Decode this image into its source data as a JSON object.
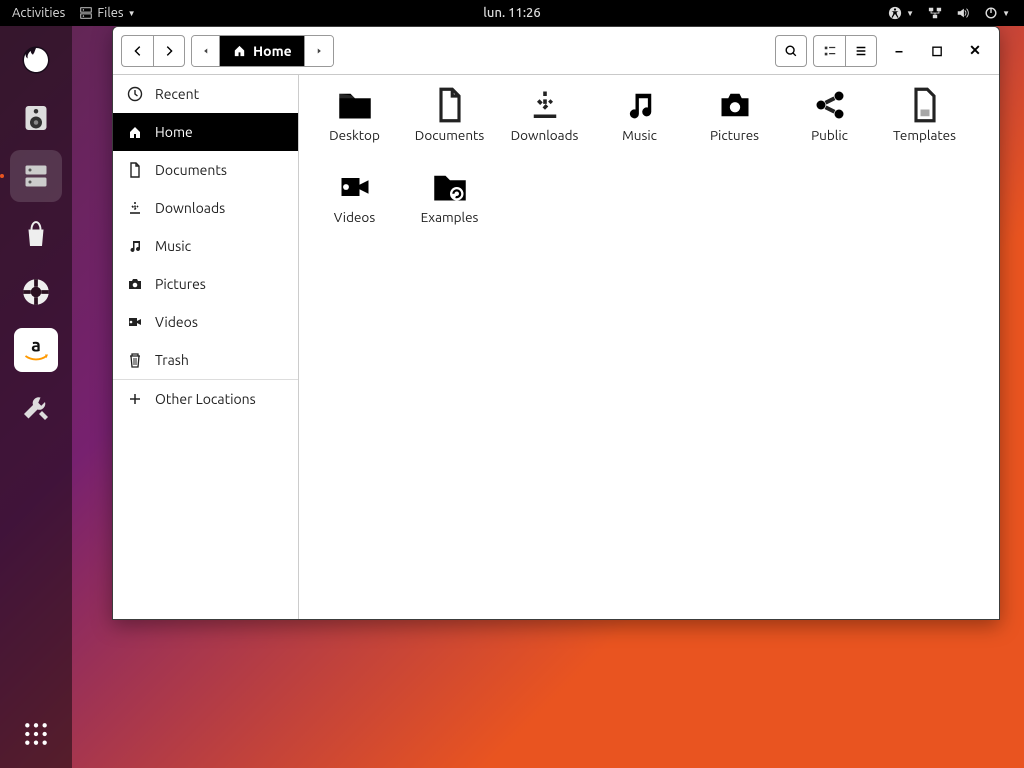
{
  "topbar": {
    "activities": "Activities",
    "app_menu": "Files",
    "clock": "lun. 11:26"
  },
  "window": {
    "path_label": "Home"
  },
  "sidebar": {
    "items": [
      {
        "id": "recent",
        "label": "Recent"
      },
      {
        "id": "home",
        "label": "Home",
        "selected": true
      },
      {
        "id": "documents",
        "label": "Documents"
      },
      {
        "id": "downloads",
        "label": "Downloads"
      },
      {
        "id": "music",
        "label": "Music"
      },
      {
        "id": "pictures",
        "label": "Pictures"
      },
      {
        "id": "videos",
        "label": "Videos"
      },
      {
        "id": "trash",
        "label": "Trash"
      }
    ],
    "other_locations": "Other Locations"
  },
  "files": [
    {
      "id": "desktop",
      "label": "Desktop",
      "icon": "folder"
    },
    {
      "id": "documents",
      "label": "Documents",
      "icon": "doc"
    },
    {
      "id": "downloads",
      "label": "Downloads",
      "icon": "download"
    },
    {
      "id": "music",
      "label": "Music",
      "icon": "music"
    },
    {
      "id": "pictures",
      "label": "Pictures",
      "icon": "camera"
    },
    {
      "id": "public",
      "label": "Public",
      "icon": "share"
    },
    {
      "id": "templates",
      "label": "Templates",
      "icon": "template"
    },
    {
      "id": "videos",
      "label": "Videos",
      "icon": "video"
    },
    {
      "id": "examples",
      "label": "Examples",
      "icon": "folder-link"
    }
  ]
}
